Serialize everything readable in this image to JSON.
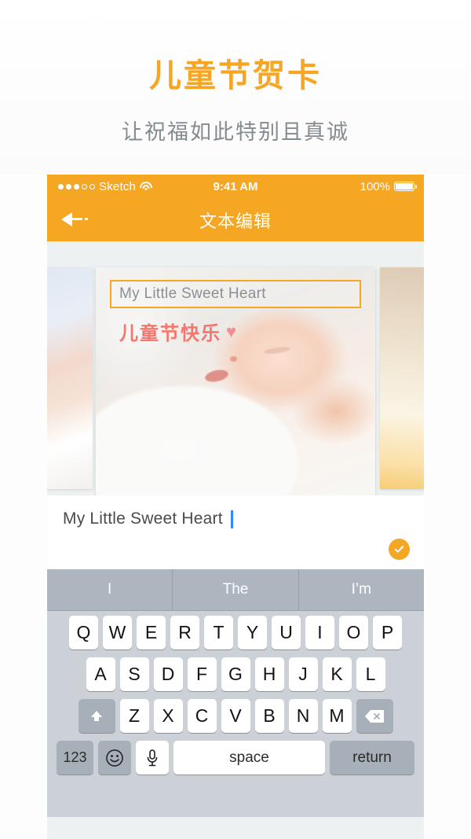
{
  "promo": {
    "title": "儿童节贺卡",
    "subtitle": "让祝福如此特别且真诚",
    "title_color": "#f6a623",
    "subtitle_color": "#838c91"
  },
  "status_bar": {
    "carrier": "Sketch",
    "time": "9:41 AM",
    "battery": "100%",
    "signal_dots_filled": 3,
    "signal_dots_total": 5,
    "wifi_icon": "wifi-icon",
    "battery_icon": "battery-full-icon"
  },
  "nav_bar": {
    "title": "文本编辑",
    "back_icon": "back-arrow-icon",
    "background": "#f5a623"
  },
  "card": {
    "overlay_text": "My Little Sweet Heart",
    "overlay_border_color": "#f5a623",
    "greeting": "儿童节快乐",
    "greeting_heart": "♥",
    "greeting_color": "#f5766c"
  },
  "input_panel": {
    "value": "My Little Sweet Heart",
    "placeholder": "My Little Sweet Heart",
    "confirm_icon": "check-circle-icon",
    "confirm_color": "#f5a623"
  },
  "suggestions": [
    {
      "label": "I"
    },
    {
      "label": "The"
    },
    {
      "label": "I’m"
    }
  ],
  "keyboard": {
    "row1": [
      "Q",
      "W",
      "E",
      "R",
      "T",
      "Y",
      "U",
      "I",
      "O",
      "P"
    ],
    "row2": [
      "A",
      "S",
      "D",
      "F",
      "G",
      "H",
      "J",
      "K",
      "L"
    ],
    "row3": [
      "Z",
      "X",
      "C",
      "V",
      "B",
      "N",
      "M"
    ],
    "shift_icon": "shift-up-icon",
    "delete_icon": "backspace-icon",
    "numeric_label": "123",
    "emoji_icon": "smiley-icon",
    "mic_icon": "microphone-icon",
    "space_label": "space",
    "return_label": "return"
  }
}
